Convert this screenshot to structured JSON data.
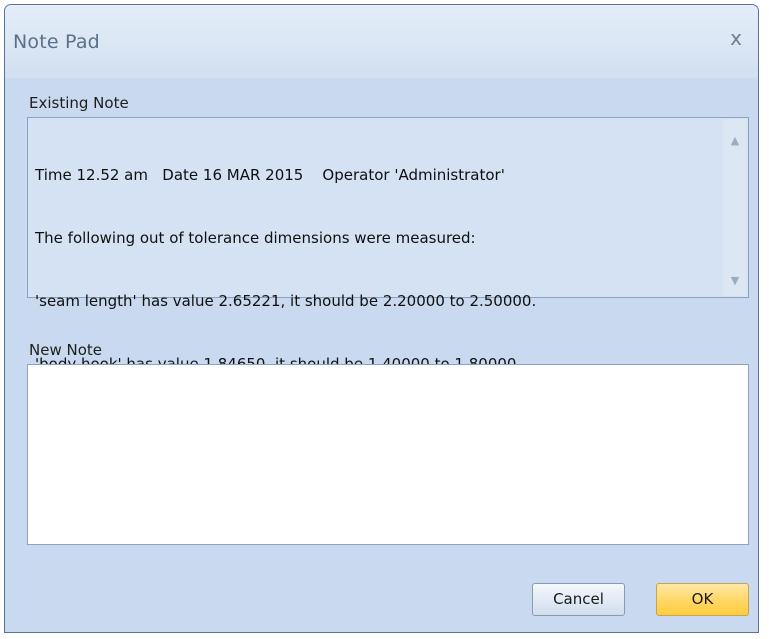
{
  "window": {
    "title": "Note Pad",
    "close_glyph": "x"
  },
  "existing_note": {
    "label": "Existing Note",
    "lines": [
      "Time 12.52 am   Date 16 MAR 2015    Operator 'Administrator'",
      "The following out of tolerance dimensions were measured:",
      "'seam length' has value 2.65221, it should be 2.20000 to 2.50000.",
      "'body hook' has value 1.84650, it should be 1.40000 to 1.80000."
    ],
    "scroll_up_glyph": "▲",
    "scroll_down_glyph": "▼"
  },
  "new_note": {
    "label": "New Note",
    "value": ""
  },
  "buttons": {
    "cancel_label": "Cancel",
    "ok_label": "OK"
  },
  "colors": {
    "window_bg": "#c9daf0",
    "title_text": "#5d6f8a",
    "ok_accent": "#ffd86a"
  }
}
